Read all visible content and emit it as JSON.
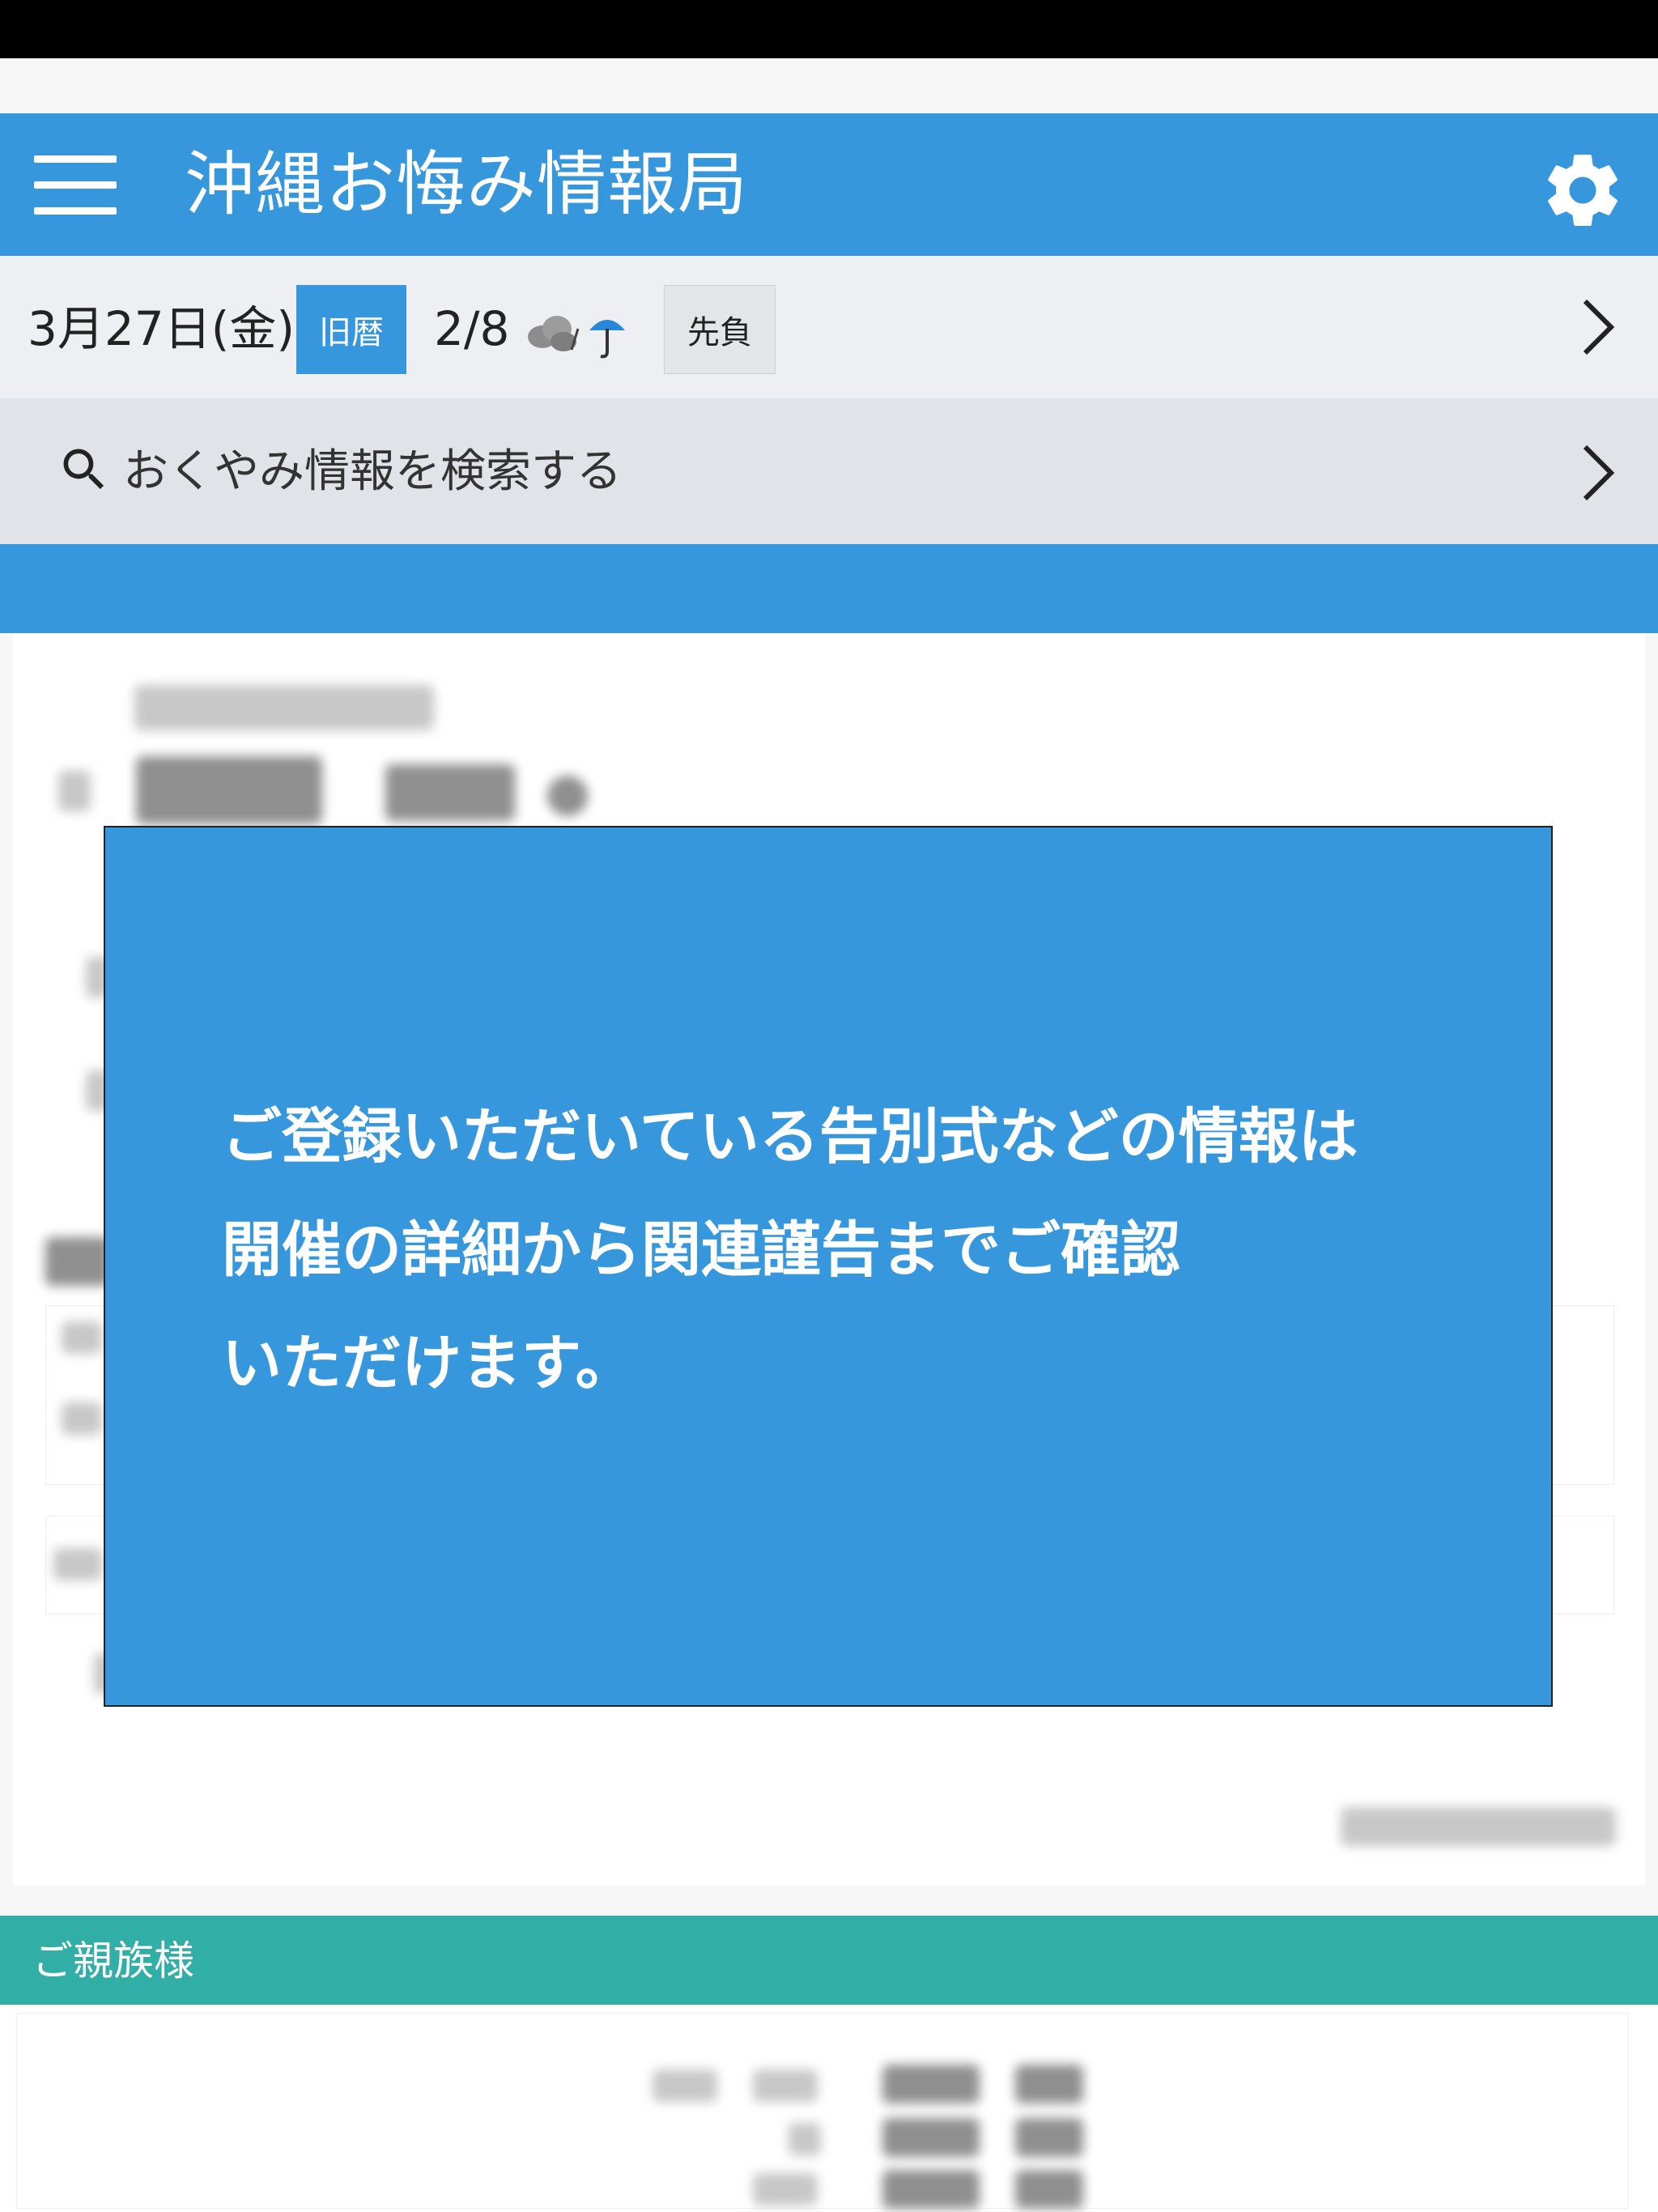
{
  "app": {
    "title": "沖縄お悔み情報局",
    "menu_icon": "hamburger-icon",
    "settings_icon": "gear-icon"
  },
  "date_row": {
    "date": "3月27日(金)",
    "kyureki_label": "旧暦",
    "lunar_date": "2/8",
    "weather_icon": "cloud-umbrella-icon",
    "rokuyo": "先負"
  },
  "search": {
    "label": "おくやみ情報を検索する",
    "icon": "search-icon"
  },
  "overlay": {
    "lines": [
      "ご登録いただいている告別式などの情報は",
      "開催の詳細から関連謹告までご確認",
      "いただけます。"
    ]
  },
  "relatives": {
    "header": "ご親族様"
  },
  "colors": {
    "primary": "#3797dd",
    "relatives_header": "#31aea6",
    "row_bg": "#eeeff2",
    "search_bg": "#e0e4e9"
  }
}
